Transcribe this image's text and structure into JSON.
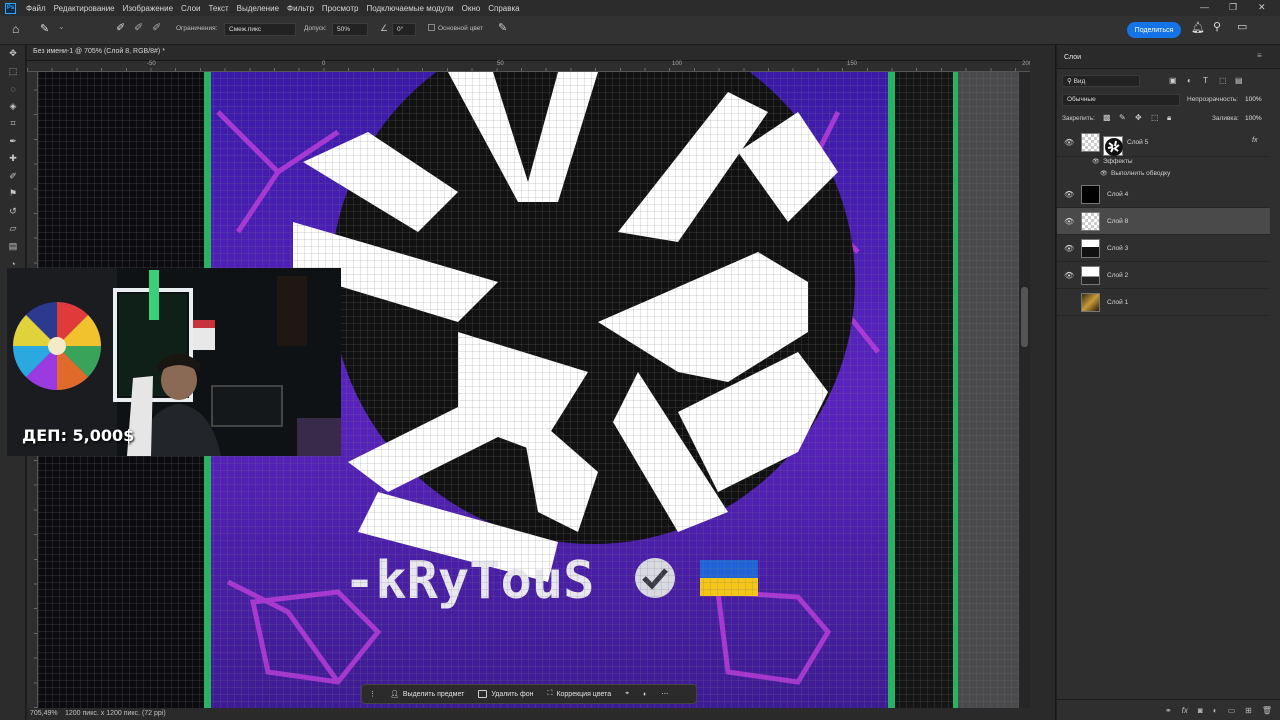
{
  "menu": {
    "items": [
      "Файл",
      "Редактирование",
      "Изображение",
      "Слои",
      "Текст",
      "Выделение",
      "Фильтр",
      "Просмотр",
      "Подключаемые модули",
      "Окно",
      "Справка"
    ]
  },
  "options": {
    "limit_label": "Ограничения:",
    "limit_value": "Смеж.пикс",
    "tolerance_label": "Допуск:",
    "tolerance_value": "50%",
    "angle_value": "0°",
    "sample_label": "Основной цвет",
    "share_label": "Поделиться"
  },
  "document": {
    "tab_title": "Без имени-1 @ 705% (Слой 8, RGB/8#) *",
    "zoom": "705,49%",
    "size_info": "1200 пикс. x 1200 пикс. (72 ppi)",
    "ruler_labels": [
      "-50",
      "0",
      "50",
      "100",
      "150",
      "200"
    ]
  },
  "canvas": {
    "nickname": "-kRyTouS",
    "colors": {
      "purple": "#5a1fb0",
      "magenta": "#d03ae8",
      "green": "#1fae5a",
      "flag_blue": "#1e64d8",
      "flag_yellow": "#f5c518"
    }
  },
  "taskbar": {
    "select_subject": "Выделить предмет",
    "remove_bg": "Удалить фон",
    "color_correct": "Коррекция цвета"
  },
  "layers_panel": {
    "tab": "Слои",
    "filter_kind": "Вид",
    "blend_mode": "Обычные",
    "opacity_label": "Непрозрачность:",
    "opacity_value": "100%",
    "lock_label": "Закрепить:",
    "fill_label": "Заливка:",
    "fill_value": "100%",
    "effects_label": "Эффекты",
    "stroke_label": "Выполнить обводку",
    "layers": [
      {
        "name": "Слой 5",
        "selected": false
      },
      {
        "name": "Слой 4",
        "selected": false
      },
      {
        "name": "Слой 8",
        "selected": true
      },
      {
        "name": "Слой 3",
        "selected": false
      },
      {
        "name": "Слой 2",
        "selected": false
      },
      {
        "name": "Слой 1",
        "selected": false
      }
    ]
  },
  "overlay": {
    "deposit_text": "ДЕП: 5,000$"
  }
}
